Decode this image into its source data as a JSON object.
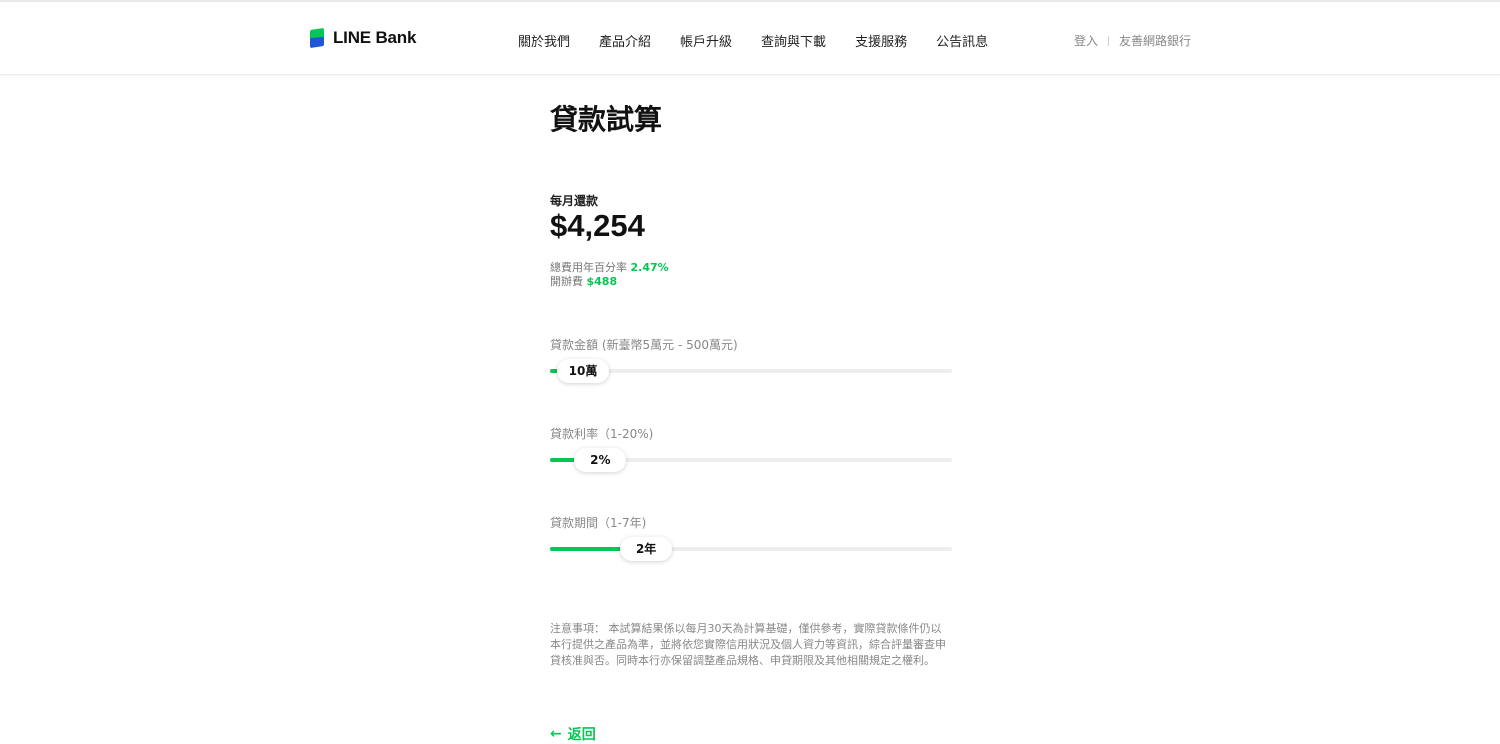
{
  "brand": {
    "name": "LINE Bank",
    "colors": {
      "accent": "#06c755",
      "logo_blue": "#1e56d6"
    }
  },
  "nav": {
    "items": [
      "關於我們",
      "產品介紹",
      "帳戶升級",
      "查詢與下載",
      "支援服務",
      "公告訊息"
    ]
  },
  "auth": {
    "login": "登入",
    "partner_bank": "友善網路銀行"
  },
  "page": {
    "title": "貸款試算"
  },
  "result": {
    "monthly_label": "每月還款",
    "monthly_value": "$4,254",
    "apr_label": "總費用年百分率",
    "apr_value": "2.47%",
    "fee_label": "開辦費",
    "fee_value": "$488"
  },
  "sliders": [
    {
      "label": "貸款金額 (新臺幣5萬元 - 500萬元)",
      "value_text": "10萬",
      "fraction": 0.01
    },
    {
      "label": "貸款利率（1-20%)",
      "value_text": "2%",
      "fraction": 0.053
    },
    {
      "label": "貸款期間（1-7年)",
      "value_text": "2年",
      "fraction": 0.167
    }
  ],
  "notice": "注意事項： 本試算結果係以每月30天為計算基礎，僅供參考，實際貸款條件仍以本行提供之產品為準，並將依您實際信用狀況及個人資力等資訊，綜合評量審查申貸核准與否。同時本行亦保留調整產品規格、申貸期限及其他相關規定之權利。",
  "back": {
    "label": "返回",
    "icon": "arrow-left-icon"
  }
}
